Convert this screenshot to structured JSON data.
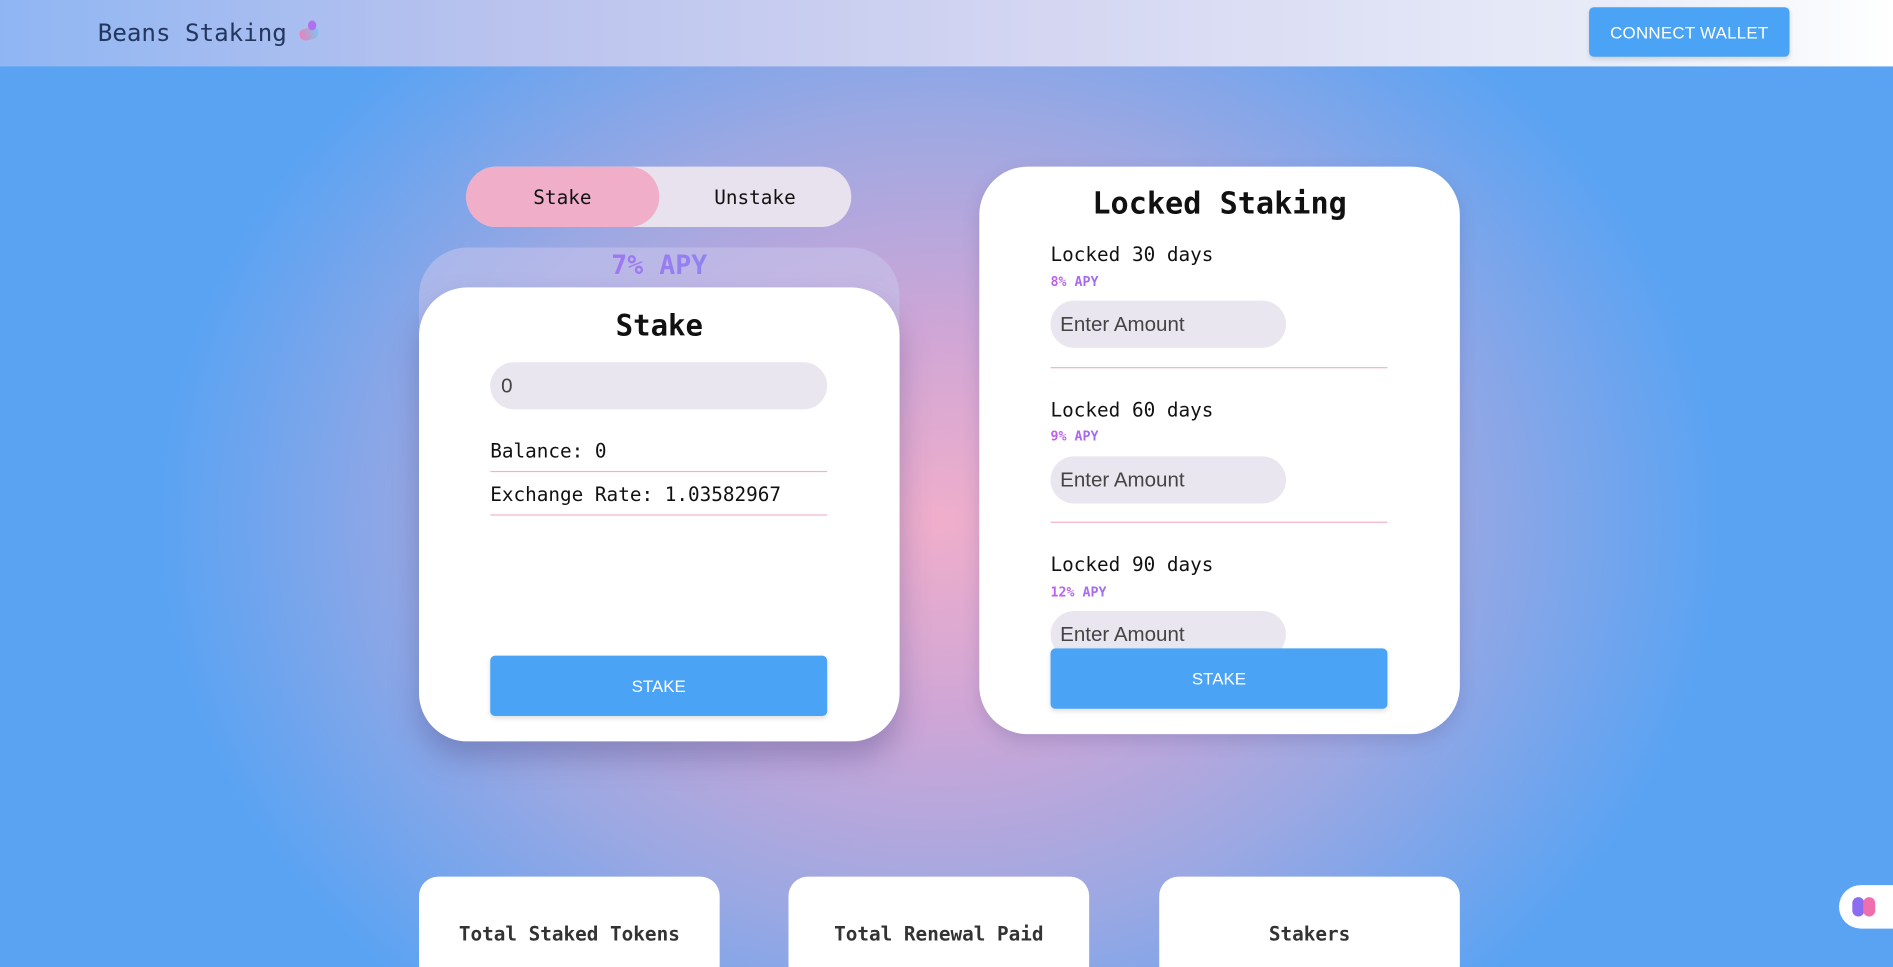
{
  "header": {
    "brand_title": "Beans Staking",
    "brand_icon": "bean-icon",
    "connect_wallet_label": "CONNECT WALLET"
  },
  "stake_toggle": {
    "options": [
      "Stake",
      "Unstake"
    ],
    "active": "Stake"
  },
  "stake_panel": {
    "apy_label": "7% APY",
    "title": "Stake",
    "amount_value": "0",
    "balance_text": "Balance: 0",
    "exchange_rate_text": "Exchange Rate: 1.03582967",
    "stake_button_label": "STAKE"
  },
  "locked_staking": {
    "title": "Locked Staking",
    "tiers": [
      {
        "label": "Locked 30 days",
        "apy": "8% APY",
        "placeholder": "Enter Amount"
      },
      {
        "label": "Locked 60 days",
        "apy": "9% APY",
        "placeholder": "Enter Amount"
      },
      {
        "label": "Locked 90 days",
        "apy": "12% APY",
        "placeholder": "Enter Amount"
      }
    ],
    "stake_button_label": "STAKE"
  },
  "stats": [
    {
      "title": "Total Staked Tokens"
    },
    {
      "title": "Total Renewal Paid"
    },
    {
      "title": "Stakers"
    }
  ],
  "floating_widget": {
    "icon": "brain-icon"
  },
  "colors": {
    "accent_blue": "#4aa3f5",
    "toggle_active": "#f0aec8",
    "apy_gradient_start": "#c45cf0",
    "apy_gradient_end": "#6d9df2"
  }
}
